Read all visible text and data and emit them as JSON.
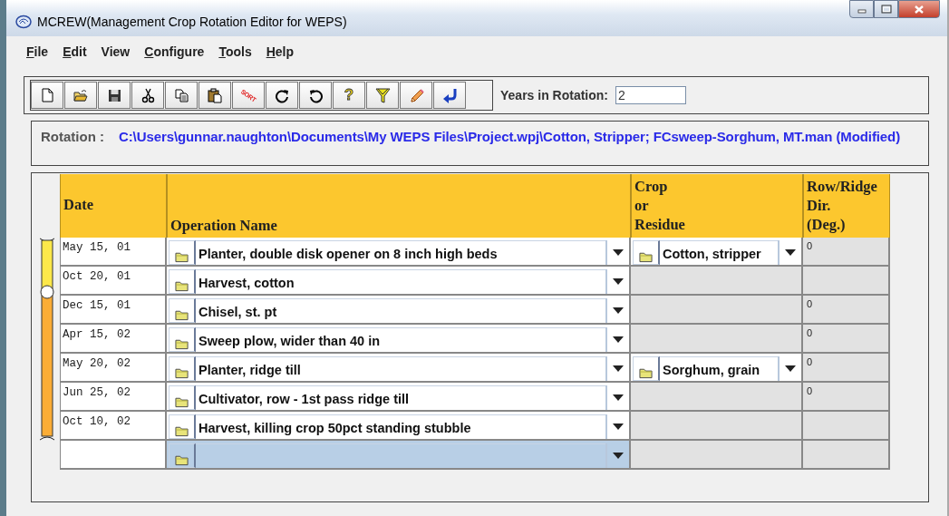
{
  "window": {
    "title": "MCREW(Management Crop Rotation Editor for WEPS)"
  },
  "menu": [
    {
      "label": "File",
      "underlined": true
    },
    {
      "label": "Edit",
      "underlined": true
    },
    {
      "label": "View",
      "underlined": false
    },
    {
      "label": "Configure",
      "underlined": true
    },
    {
      "label": "Tools",
      "underlined": true
    },
    {
      "label": "Help",
      "underlined": true
    }
  ],
  "toolbar": [
    {
      "kind": "new"
    },
    {
      "kind": "open"
    },
    {
      "kind": "save"
    },
    {
      "kind": "cut"
    },
    {
      "kind": "copy"
    },
    {
      "kind": "paste"
    },
    {
      "kind": "sort",
      "label": "SORT"
    },
    {
      "kind": "redo"
    },
    {
      "kind": "undo"
    },
    {
      "kind": "help",
      "label": "?"
    },
    {
      "kind": "filter"
    },
    {
      "kind": "pencil"
    },
    {
      "kind": "enter"
    }
  ],
  "years": {
    "label": "Years in Rotation:",
    "value": "2"
  },
  "rotation": {
    "label": "Rotation :",
    "path": "C:\\Users\\gunnar.naughton\\Documents\\My WEPS Files\\Project.wpj\\Cotton, Stripper; FCsweep-Sorghum, MT.man  (Modified)"
  },
  "table": {
    "columns": [
      "Date",
      "Operation Name",
      "Crop\nor\nResidue",
      "Row/Ridge\nDir.\n(Deg.)"
    ],
    "rows": [
      {
        "date": "May 15, 01",
        "operation": "Planter, double disk opener on 8 inch high beds",
        "crop": "Cotton, stripper",
        "direction": "0",
        "selected": false
      },
      {
        "date": "Oct 20, 01",
        "operation": "Harvest, cotton",
        "selected": false
      },
      {
        "date": "Dec 15, 01",
        "operation": "Chisel, st. pt",
        "direction": "0",
        "selected": false
      },
      {
        "date": "Apr 15, 02",
        "operation": "Sweep plow, wider than 40 in",
        "direction": "0",
        "selected": false
      },
      {
        "date": "May 20, 02",
        "operation": "Planter, ridge till",
        "crop": "Sorghum, grain",
        "direction": "0",
        "selected": false
      },
      {
        "date": "Jun 25, 02",
        "operation": "Cultivator, row - 1st pass ridge till",
        "direction": "0",
        "selected": false
      },
      {
        "date": "Oct 10, 02",
        "operation": "Harvest, killing crop 50pct standing stubble",
        "selected": false
      },
      {
        "date": "",
        "operation": "",
        "selected": true
      }
    ]
  }
}
